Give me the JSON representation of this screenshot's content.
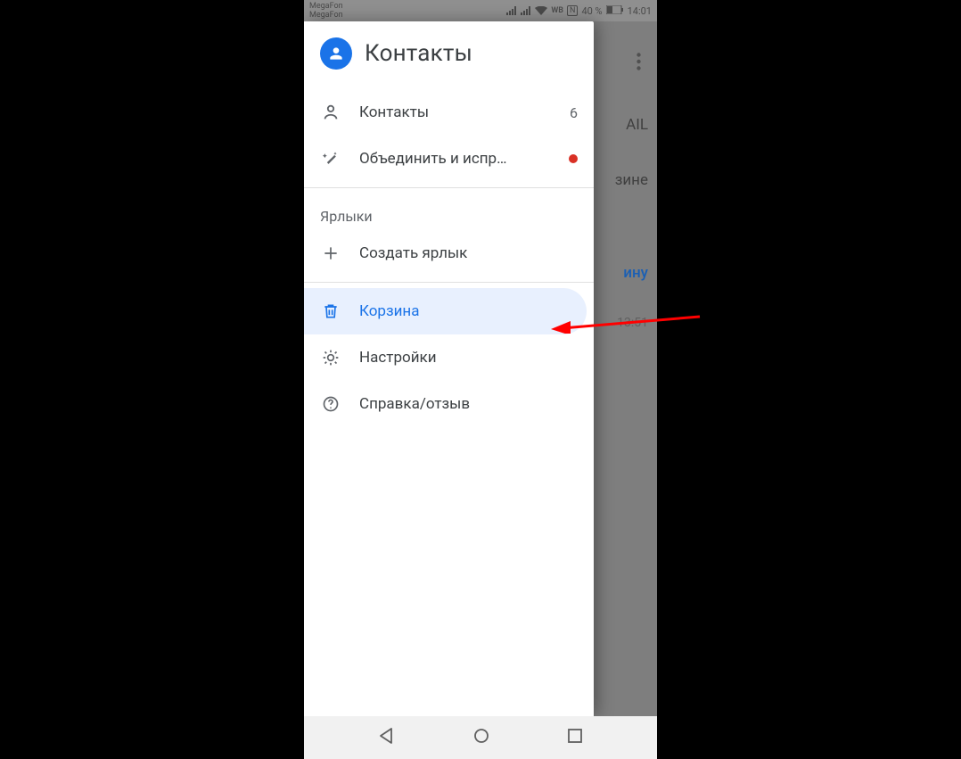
{
  "status": {
    "carrier1": "MegaFon",
    "carrier2": "MegaFon",
    "wb": "WB",
    "nfc": "N",
    "battery": "40 %",
    "time": "14:01"
  },
  "drawer": {
    "title": "Контакты",
    "items": {
      "contacts": {
        "label": "Контакты",
        "count": "6"
      },
      "merge": {
        "label": "Объединить и испр…"
      }
    },
    "labels_header": "Ярлыки",
    "create_label": "Создать ярлык",
    "trash": "Корзина",
    "settings": "Настройки",
    "help": "Справка/отзыв"
  },
  "background": {
    "tab": "AIL",
    "line1": "зине",
    "link": "ину",
    "time": "13:51"
  }
}
